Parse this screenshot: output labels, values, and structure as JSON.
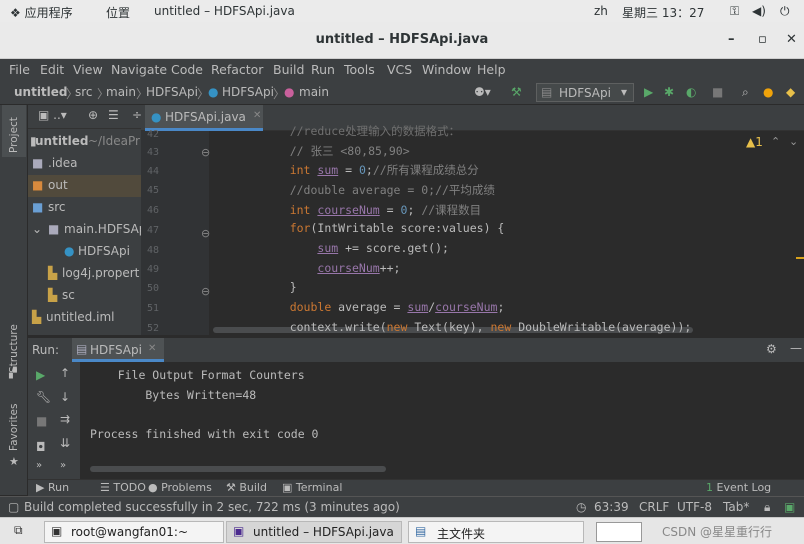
{
  "topbar": {
    "apps": "应用程序",
    "places": "位置",
    "window": "untitled – HDFSApi.java",
    "lang": "zh",
    "clock": "星期三 13：27"
  },
  "window": {
    "title": "untitled – HDFSApi.java",
    "minimize": "–",
    "maximize": "▫",
    "close": "✕"
  },
  "menu": [
    "File",
    "Edit",
    "View",
    "Navigate",
    "Code",
    "Refactor",
    "Build",
    "Run",
    "Tools",
    "VCS",
    "Window",
    "Help"
  ],
  "nav": {
    "project": "untitled",
    "src": "src",
    "main": "main",
    "hdfsapi": "HDFSApi",
    "class": "HDFSApi",
    "method": "main",
    "runconfig": "HDFSApi"
  },
  "project": {
    "root": "untitled",
    "root_path": "~/IdeaPr",
    "items": [
      ".idea",
      "out",
      "src",
      "main.HDFSAp",
      "HDFSApi",
      "log4j.propert",
      "sc",
      "untitled.iml"
    ]
  },
  "editor": {
    "tab": "HDFSApi.java",
    "warning": "▲1",
    "lines": [
      {
        "n": "42",
        "t": "    //reduce处理输入的数据格式："
      },
      {
        "n": "43",
        "t": "    // 张三 <80,85,90>"
      },
      {
        "n": "44",
        "t": "    int sum = 0;//所有课程成绩总分"
      },
      {
        "n": "45",
        "t": "    //double average = 0;//平均成绩"
      },
      {
        "n": "46",
        "t": "    int courseNum = 0; //课程数目"
      },
      {
        "n": "47",
        "t": "    for(IntWritable score:values) {"
      },
      {
        "n": "48",
        "t": "        sum += score.get();"
      },
      {
        "n": "49",
        "t": "        courseNum++;"
      },
      {
        "n": "50",
        "t": "    }"
      },
      {
        "n": "51",
        "t": "    double average = sum/courseNum;"
      },
      {
        "n": "52",
        "t": "    context.write(new Text(key), new DoubleWritable(average));"
      }
    ]
  },
  "run": {
    "label": "Run:",
    "tab": "HDFSApi",
    "console": [
      "    File Output Format Counters",
      "        Bytes Written=48",
      "",
      "Process finished with exit code 0"
    ]
  },
  "tools": {
    "run": "Run",
    "todo": "TODO",
    "problems": "Problems",
    "build": "Build",
    "terminal": "Terminal",
    "eventlog": "Event Log",
    "eventcount": "1"
  },
  "sidetabs": {
    "project": "Project",
    "structure": "Structure",
    "favorites": "Favorites"
  },
  "status": {
    "message": "Build completed successfully in 2 sec, 722 ms (3 minutes ago)",
    "position": "63:39",
    "lineend": "CRLF",
    "encoding": "UTF-8",
    "indent": "Tab*"
  },
  "taskbar": {
    "terminal": "root@wangfan01:~",
    "ide": "untitled – HDFSApi.java",
    "files": "主文件夹",
    "watermark": "CSDN @星星重行行"
  }
}
